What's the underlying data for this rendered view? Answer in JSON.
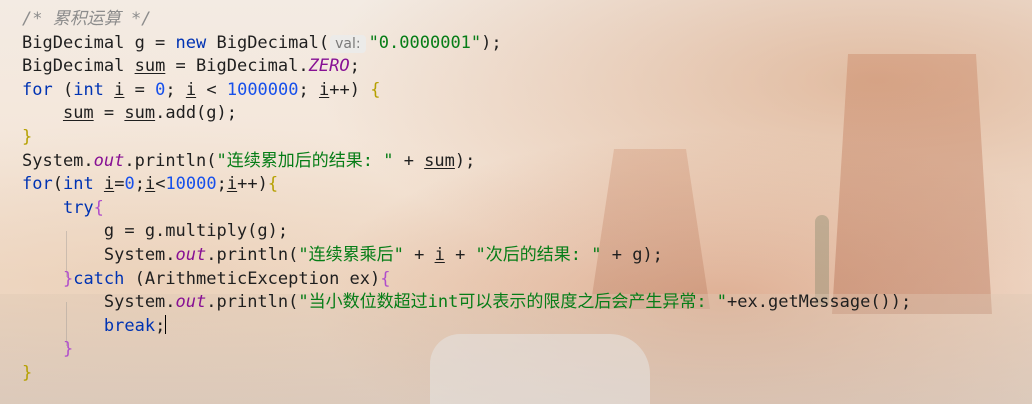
{
  "editor": {
    "lines": [
      {
        "parts": [
          {
            "t": "/* 累积运算 */",
            "c": "cmt"
          }
        ]
      },
      {
        "parts": [
          {
            "t": "BigDecimal g = ",
            "c": ""
          },
          {
            "t": "new",
            "c": "kw"
          },
          {
            "t": " BigDecimal(",
            "c": ""
          },
          {
            "t": "val:",
            "c": "hint"
          },
          {
            "t": "\"0.0000001\"",
            "c": "str"
          },
          {
            "t": ");",
            "c": ""
          }
        ]
      },
      {
        "parts": [
          {
            "t": "BigDecimal ",
            "c": ""
          },
          {
            "t": "sum",
            "c": "var"
          },
          {
            "t": " = BigDecimal.",
            "c": ""
          },
          {
            "t": "ZERO",
            "c": "fld"
          },
          {
            "t": ";",
            "c": ""
          }
        ]
      },
      {
        "parts": [
          {
            "t": "for",
            "c": "kw"
          },
          {
            "t": " (",
            "c": ""
          },
          {
            "t": "int",
            "c": "kw"
          },
          {
            "t": " ",
            "c": ""
          },
          {
            "t": "i",
            "c": "var"
          },
          {
            "t": " = ",
            "c": ""
          },
          {
            "t": "0",
            "c": "num"
          },
          {
            "t": "; ",
            "c": ""
          },
          {
            "t": "i",
            "c": "var"
          },
          {
            "t": " < ",
            "c": ""
          },
          {
            "t": "1000000",
            "c": "num"
          },
          {
            "t": "; ",
            "c": ""
          },
          {
            "t": "i",
            "c": "var"
          },
          {
            "t": "++) ",
            "c": ""
          },
          {
            "t": "{",
            "c": "brace"
          }
        ]
      },
      {
        "parts": [
          {
            "t": "    ",
            "c": ""
          },
          {
            "t": "sum",
            "c": "var"
          },
          {
            "t": " = ",
            "c": ""
          },
          {
            "t": "sum",
            "c": "var"
          },
          {
            "t": ".add(g);",
            "c": ""
          }
        ]
      },
      {
        "parts": [
          {
            "t": "}",
            "c": "brace"
          }
        ]
      },
      {
        "parts": [
          {
            "t": "System.",
            "c": ""
          },
          {
            "t": "out",
            "c": "fld"
          },
          {
            "t": ".println(",
            "c": ""
          },
          {
            "t": "\"连续累加后的结果: \"",
            "c": "str"
          },
          {
            "t": " + ",
            "c": ""
          },
          {
            "t": "sum",
            "c": "var"
          },
          {
            "t": ");",
            "c": ""
          }
        ]
      },
      {
        "parts": [
          {
            "t": "for",
            "c": "kw"
          },
          {
            "t": "(",
            "c": ""
          },
          {
            "t": "int",
            "c": "kw"
          },
          {
            "t": " ",
            "c": ""
          },
          {
            "t": "i",
            "c": "var"
          },
          {
            "t": "=",
            "c": ""
          },
          {
            "t": "0",
            "c": "num"
          },
          {
            "t": ";",
            "c": ""
          },
          {
            "t": "i",
            "c": "var"
          },
          {
            "t": "<",
            "c": ""
          },
          {
            "t": "10000",
            "c": "num"
          },
          {
            "t": ";",
            "c": ""
          },
          {
            "t": "i",
            "c": "var"
          },
          {
            "t": "++)",
            "c": ""
          },
          {
            "t": "{",
            "c": "brace"
          }
        ]
      },
      {
        "parts": [
          {
            "t": "    ",
            "c": ""
          },
          {
            "t": "try",
            "c": "kw"
          },
          {
            "t": "{",
            "c": "brace-p"
          }
        ]
      },
      {
        "parts": [
          {
            "t": "        g = g.multiply(g);",
            "c": ""
          }
        ]
      },
      {
        "parts": [
          {
            "t": "        System.",
            "c": ""
          },
          {
            "t": "out",
            "c": "fld"
          },
          {
            "t": ".println(",
            "c": ""
          },
          {
            "t": "\"连续累乘后\"",
            "c": "str"
          },
          {
            "t": " + ",
            "c": ""
          },
          {
            "t": "i",
            "c": "var"
          },
          {
            "t": " + ",
            "c": ""
          },
          {
            "t": "\"次后的结果: \"",
            "c": "str"
          },
          {
            "t": " + g);",
            "c": ""
          }
        ]
      },
      {
        "parts": [
          {
            "t": "    ",
            "c": ""
          },
          {
            "t": "}",
            "c": "brace-p"
          },
          {
            "t": "catch",
            "c": "kw"
          },
          {
            "t": " (ArithmeticException ex)",
            "c": ""
          },
          {
            "t": "{",
            "c": "brace-p"
          }
        ]
      },
      {
        "parts": [
          {
            "t": "        System.",
            "c": ""
          },
          {
            "t": "out",
            "c": "fld"
          },
          {
            "t": ".println(",
            "c": ""
          },
          {
            "t": "\"当小数位数超过int可以表示的限度之后会产生异常: \"",
            "c": "str"
          },
          {
            "t": "+ex.getMessage());",
            "c": ""
          }
        ]
      },
      {
        "parts": [
          {
            "t": "        ",
            "c": ""
          },
          {
            "t": "break",
            "c": "kw"
          },
          {
            "t": ";",
            "c": ""
          },
          {
            "t": "",
            "c": "caret"
          }
        ]
      },
      {
        "parts": [
          {
            "t": "    ",
            "c": ""
          },
          {
            "t": "}",
            "c": "brace-p"
          }
        ]
      },
      {
        "parts": [
          {
            "t": "}",
            "c": "brace"
          }
        ]
      }
    ]
  }
}
